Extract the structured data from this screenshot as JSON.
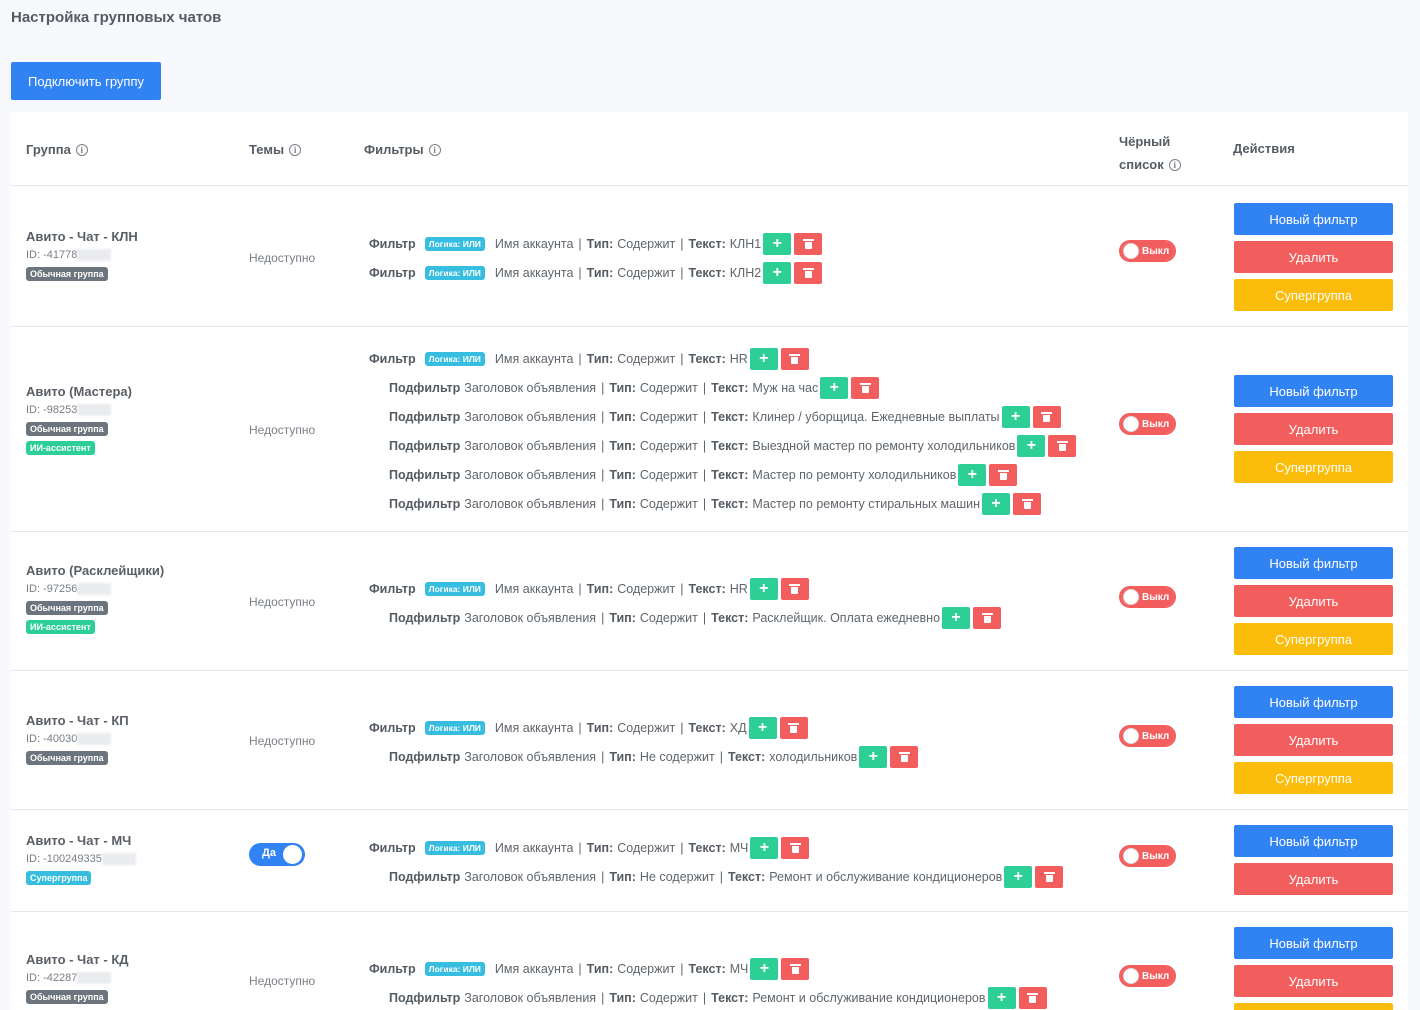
{
  "page": {
    "title": "Настройка групповых чатов",
    "connect_label": "Подключить группу"
  },
  "table": {
    "headers": {
      "group": "Группа",
      "topics": "Темы",
      "filters": "Фильтры",
      "blacklist_1": "Чёрный",
      "blacklist_2": "список",
      "actions": "Действия"
    },
    "unavailable": "Недоступно",
    "toggle_off": "Выкл",
    "toggle_on": "Да",
    "labels": {
      "filter": "Фильтр",
      "subfilter": "Подфильтр",
      "logic": "Логика: ИЛИ",
      "type": "Тип:",
      "text": "Текст:",
      "pipe": "|"
    },
    "buttons": {
      "new_filter": "Новый фильтр",
      "delete": "Удалить",
      "supergroup": "Супергруппа",
      "plus": "+"
    },
    "badges": {
      "regular": "Обычная группа",
      "ai": "ИИ-ассистент",
      "super": "Супергруппа"
    },
    "rows": [
      {
        "name": "Авито - Чат - КЛН",
        "id": "ID: -41778",
        "filters": [
          {
            "kind": "Фильтр",
            "field": "Имя аккаунта",
            "type": "Содержит",
            "text": "КЛН1"
          },
          {
            "kind": "Фильтр",
            "field": "Имя аккаунта",
            "type": "Содержит",
            "text": "КЛН2"
          }
        ]
      },
      {
        "name": "Авито (Мастера)",
        "id": "ID: -98253",
        "filters": [
          {
            "kind": "Фильтр",
            "field": "Имя аккаунта",
            "type": "Содержит",
            "text": "HR"
          },
          {
            "kind": "Подфильтр",
            "field": "Заголовок объявления",
            "type": "Содержит",
            "text": "Муж на час"
          },
          {
            "kind": "Подфильтр",
            "field": "Заголовок объявления",
            "type": "Содержит",
            "text": "Клинер / уборщица. Ежедневные выплаты"
          },
          {
            "kind": "Подфильтр",
            "field": "Заголовок объявления",
            "type": "Содержит",
            "text": "Выездной мастер по ремонту холодильников"
          },
          {
            "kind": "Подфильтр",
            "field": "Заголовок объявления",
            "type": "Содержит",
            "text": "Мастер по ремонту холодильников"
          },
          {
            "kind": "Подфильтр",
            "field": "Заголовок объявления",
            "type": "Содержит",
            "text": "Мастер по ремонту стиральных машин"
          }
        ]
      },
      {
        "name": "Авито (Расклейщики)",
        "id": "ID: -97256",
        "filters": [
          {
            "kind": "Фильтр",
            "field": "Имя аккаунта",
            "type": "Содержит",
            "text": "HR"
          },
          {
            "kind": "Подфильтр",
            "field": "Заголовок объявления",
            "type": "Содержит",
            "text": "Расклейщик. Оплата ежедневно"
          }
        ]
      },
      {
        "name": "Авито - Чат - КП",
        "id": "ID: -40030",
        "filters": [
          {
            "kind": "Фильтр",
            "field": "Имя аккаунта",
            "type": "Содержит",
            "text": "ХД"
          },
          {
            "kind": "Подфильтр",
            "field": "Заголовок объявления",
            "type": "Не содержит",
            "text": "холодильников"
          }
        ]
      },
      {
        "name": "Авито - Чат - МЧ",
        "id": "ID: -100249335",
        "filters": [
          {
            "kind": "Фильтр",
            "field": "Имя аккаунта",
            "type": "Содержит",
            "text": "МЧ"
          },
          {
            "kind": "Подфильтр",
            "field": "Заголовок объявления",
            "type": "Не содержит",
            "text": "Ремонт и обслуживание кондиционеров"
          }
        ]
      },
      {
        "name": "Авито - Чат - КД",
        "id": "ID: -42287",
        "filters": [
          {
            "kind": "Фильтр",
            "field": "Имя аккаунта",
            "type": "Содержит",
            "text": "МЧ"
          },
          {
            "kind": "Подфильтр",
            "field": "Заголовок объявления",
            "type": "Содержит",
            "text": "Ремонт и обслуживание кондиционеров"
          }
        ]
      }
    ]
  }
}
